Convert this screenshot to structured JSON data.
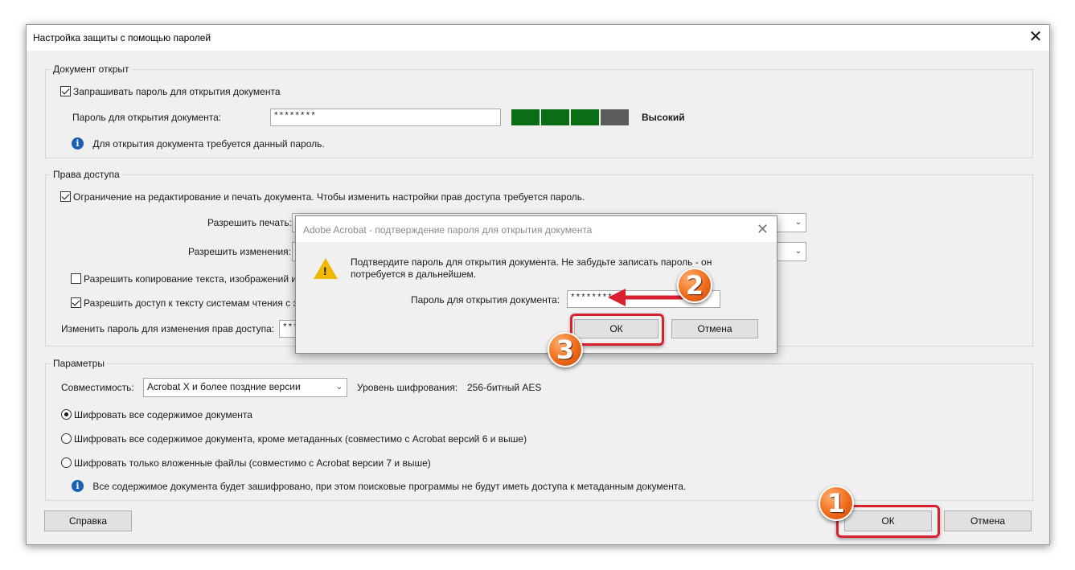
{
  "window": {
    "title": "Настройка защиты с помощью паролей",
    "close_glyph": "✕"
  },
  "open_group": {
    "legend": "Документ открыт",
    "require_password_label": "Запрашивать пароль для открытия документа",
    "require_password_checked": true,
    "password_label": "Пароль для открытия документа:",
    "password_value": "********",
    "strength_label": "Высокий",
    "strength_colors": [
      "#0a6e17",
      "#0a6e17",
      "#0a6e17",
      "#5c5c5c"
    ],
    "info_text": "Для открытия документа требуется данный пароль."
  },
  "perm_group": {
    "legend": "Права доступа",
    "restrict_label": "Ограничение на редактирование и печать документа. Чтобы изменить настройки прав доступа требуется пароль.",
    "restrict_checked": true,
    "print_label": "Разрешить печать:",
    "changes_label": "Разрешить изменения:",
    "copy_label": "Разрешить копирование текста, изображений и",
    "copy_checked": false,
    "access_label": "Разрешить доступ к тексту системам чтения с эк",
    "access_checked": true,
    "change_pwd_label": "Изменить пароль для изменения прав доступа:",
    "change_pwd_value": "****"
  },
  "params_group": {
    "legend": "Параметры",
    "compat_label": "Совместимость:",
    "compat_value": "Acrobat X и более поздние версии",
    "enc_level_label": "Уровень шифрования:",
    "enc_level_value": "256-битный AES",
    "radio1": "Шифровать все содержимое документа",
    "radio2": "Шифровать все содержимое документа, кроме метаданных (совместимо с Acrobat версий 6 и выше)",
    "radio3": "Шифровать только вложенные файлы (совместимо с Acrobat версии 7 и выше)",
    "info_text": "Все содержимое документа будет зашифровано, при этом поисковые программы не будут иметь доступа к метаданным документа."
  },
  "footer": {
    "help_label": "Справка",
    "ok_label": "ОК",
    "cancel_label": "Отмена"
  },
  "dialog": {
    "title": "Adobe Acrobat - подтверждение пароля для открытия документа",
    "close_glyph": "✕",
    "message_line1": "Подтвердите пароль для открытия документа. Не забудьте записать пароль - он",
    "message_line2": "потребуется в дальнейшем.",
    "password_label": "Пароль для открытия документа:",
    "password_value": "********",
    "ok_label": "ОК",
    "cancel_label": "Отмена"
  },
  "annotations": {
    "badge1": "1",
    "badge2": "2",
    "badge3": "3",
    "accent_color": "#d9202f",
    "badge_color": "#f06a1a"
  }
}
